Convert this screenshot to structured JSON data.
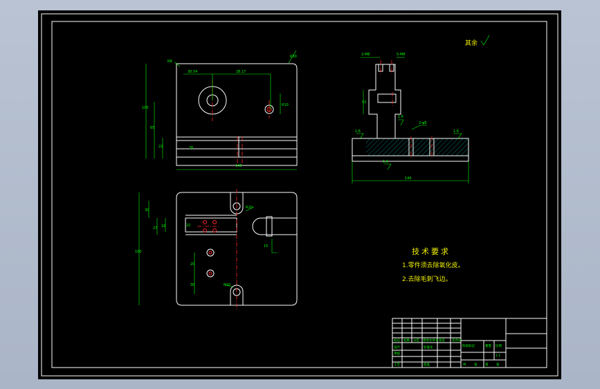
{
  "drawing": {
    "roughness_note": "其余",
    "tech_req": {
      "title": "技术要求",
      "items": [
        "1.零件须去除氧化皮。",
        "2.去除毛刺飞边。"
      ]
    },
    "top_view_dims": {
      "d1": "R8",
      "d2": "30.54",
      "d3": "28.17",
      "d4": "100",
      "d5": "65",
      "d6": "22",
      "d7": "20",
      "d8": "140",
      "d9": "R10",
      "d10": "R30"
    },
    "section_dims": {
      "s1": "2-M8",
      "s2": "5-M8",
      "s3": "42",
      "s4": "1.6",
      "s5": "2-φ8",
      "s6": "1.6",
      "s7": "1.6",
      "s8": "140",
      "s9": "1.6"
    },
    "plan_dims": {
      "p1": "30",
      "p2": "27",
      "p3": "16",
      "p4": "100",
      "p5": "20",
      "p6": "30",
      "p7": "R10",
      "p8": "R10",
      "p9": "15",
      "p10": "22"
    }
  },
  "title_block": {
    "row_labels": [
      "标记",
      "处数",
      "分区",
      "更改文件号",
      "签名",
      "年月日"
    ],
    "left_rows": [
      "设计",
      "审核",
      "工艺"
    ],
    "std": "标准化",
    "stage_label": "阶段标记",
    "weight_label": "重量",
    "scale_label": "比例",
    "scale_value": "1:1",
    "approve": "批准",
    "sheet_info": [
      "共",
      "张",
      "第",
      "张"
    ]
  }
}
